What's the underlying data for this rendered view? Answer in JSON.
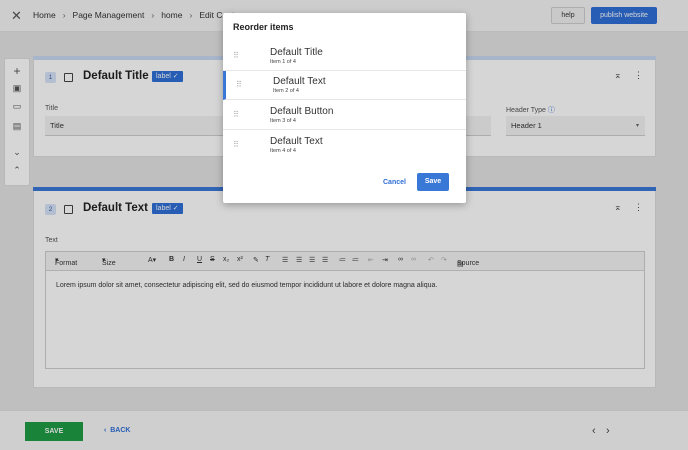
{
  "header": {
    "close_icon": "close-icon",
    "breadcrumb": [
      "Home",
      "Page Management",
      "home",
      "Edit Conte"
    ],
    "help_label": "help",
    "publish_label": "publish website"
  },
  "left_toolbar": [
    "add-icon",
    "section-icon",
    "page-icon",
    "image-icon",
    "collapse-icon",
    "expand-icon"
  ],
  "cards": [
    {
      "number": "1",
      "title": "Default Title",
      "label_tag": "label ✓",
      "fields": {
        "title_label": "Title",
        "title_value": "Title",
        "header_type_label": "Header Type",
        "header_type_value": "Header 1"
      }
    },
    {
      "number": "2",
      "title": "Default Text",
      "label_tag": "label ✓",
      "text_label": "Text",
      "toolbar": {
        "format": "Format",
        "size": "Size",
        "source": "Source"
      },
      "body": "Lorem ipsum dolor sit amet, consectetur adipiscing elit, sed do eiusmod tempor incididunt ut labore et dolore magna aliqua."
    }
  ],
  "footer": {
    "save_label": "SAVE",
    "back_label": "BACK"
  },
  "dialog": {
    "title": "Reorder items",
    "items": [
      {
        "name": "Default Title",
        "sub": "Item 1 of 4"
      },
      {
        "name": "Default Text",
        "sub": "Item 2 of 4"
      },
      {
        "name": "Default Button",
        "sub": "Item 3 of 4"
      },
      {
        "name": "Default Text",
        "sub": "Item 4 of 4"
      }
    ],
    "cancel_label": "Cancel",
    "save_label": "Save"
  },
  "colors": {
    "accent": "#2f6fd7",
    "save_green": "#1f9d46"
  }
}
